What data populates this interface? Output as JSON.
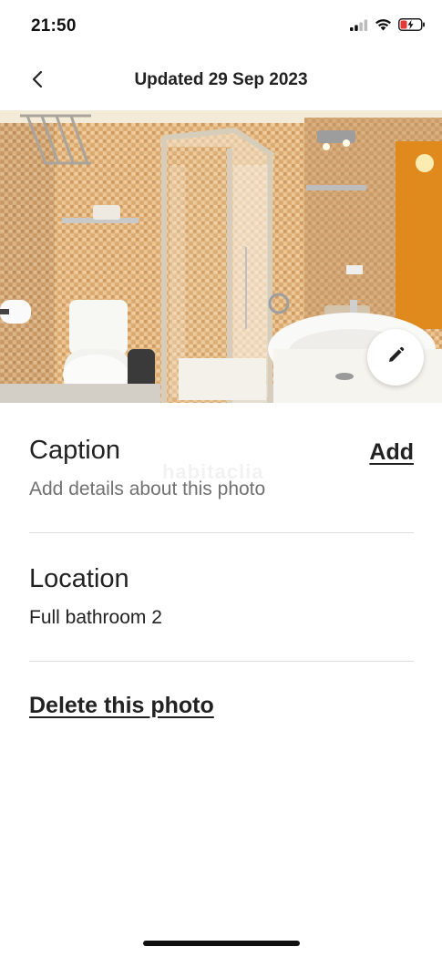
{
  "status_bar": {
    "time": "21:50",
    "icons": [
      "cellular-signal-icon",
      "wifi-icon",
      "battery-charging-icon"
    ]
  },
  "header": {
    "title": "Updated 29 Sep 2023",
    "back_icon": "chevron-left-icon"
  },
  "photo": {
    "description_icon": "bathroom-photo",
    "edit_icon": "pencil-icon"
  },
  "caption": {
    "label": "Caption",
    "placeholder": "Add details about this photo",
    "action": "Add"
  },
  "location": {
    "label": "Location",
    "value": "Full bathroom 2"
  },
  "actions": {
    "delete": "Delete this photo"
  },
  "watermark": "habitaclia",
  "colors": {
    "text_primary": "#222222",
    "text_secondary": "#717171",
    "divider": "#dddddd"
  }
}
